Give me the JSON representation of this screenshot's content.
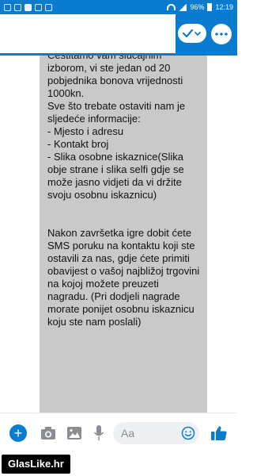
{
  "status_bar": {
    "battery": "96%",
    "time": "12:19"
  },
  "message": {
    "intro": "Čestitamo vam slučajnim izborom, vi ste jedan od 20 pobjednika bonova vrijednosti 1000kn.\nSve što trebate ostaviti nam je sljedeće informacije:",
    "items": [
      "- Mjesto i adresu",
      "- Kontakt broj",
      "- Slika osobne iskaznice(Slika obje strane i slika selfi gdje se može jasno vidjeti da vi držite svoju osobnu iskaznicu)"
    ],
    "outro": "Nakon završetka igre dobit ćete SMS poruku na kontaktu koji ste ostavili za nas, gdje ćete primiti obavijest o vašoj najbližoj trgovini na kojoj možete preuzeti nagradu. (Pri dodjeli nagrade morate ponijet osobnu iskaznicu koju ste nam poslali)"
  },
  "composer": {
    "placeholder": "Aa"
  },
  "watermark": "GlasLike.hr",
  "colors": {
    "accent": "#0a7ccf",
    "bubble": "#c9c9c9"
  }
}
